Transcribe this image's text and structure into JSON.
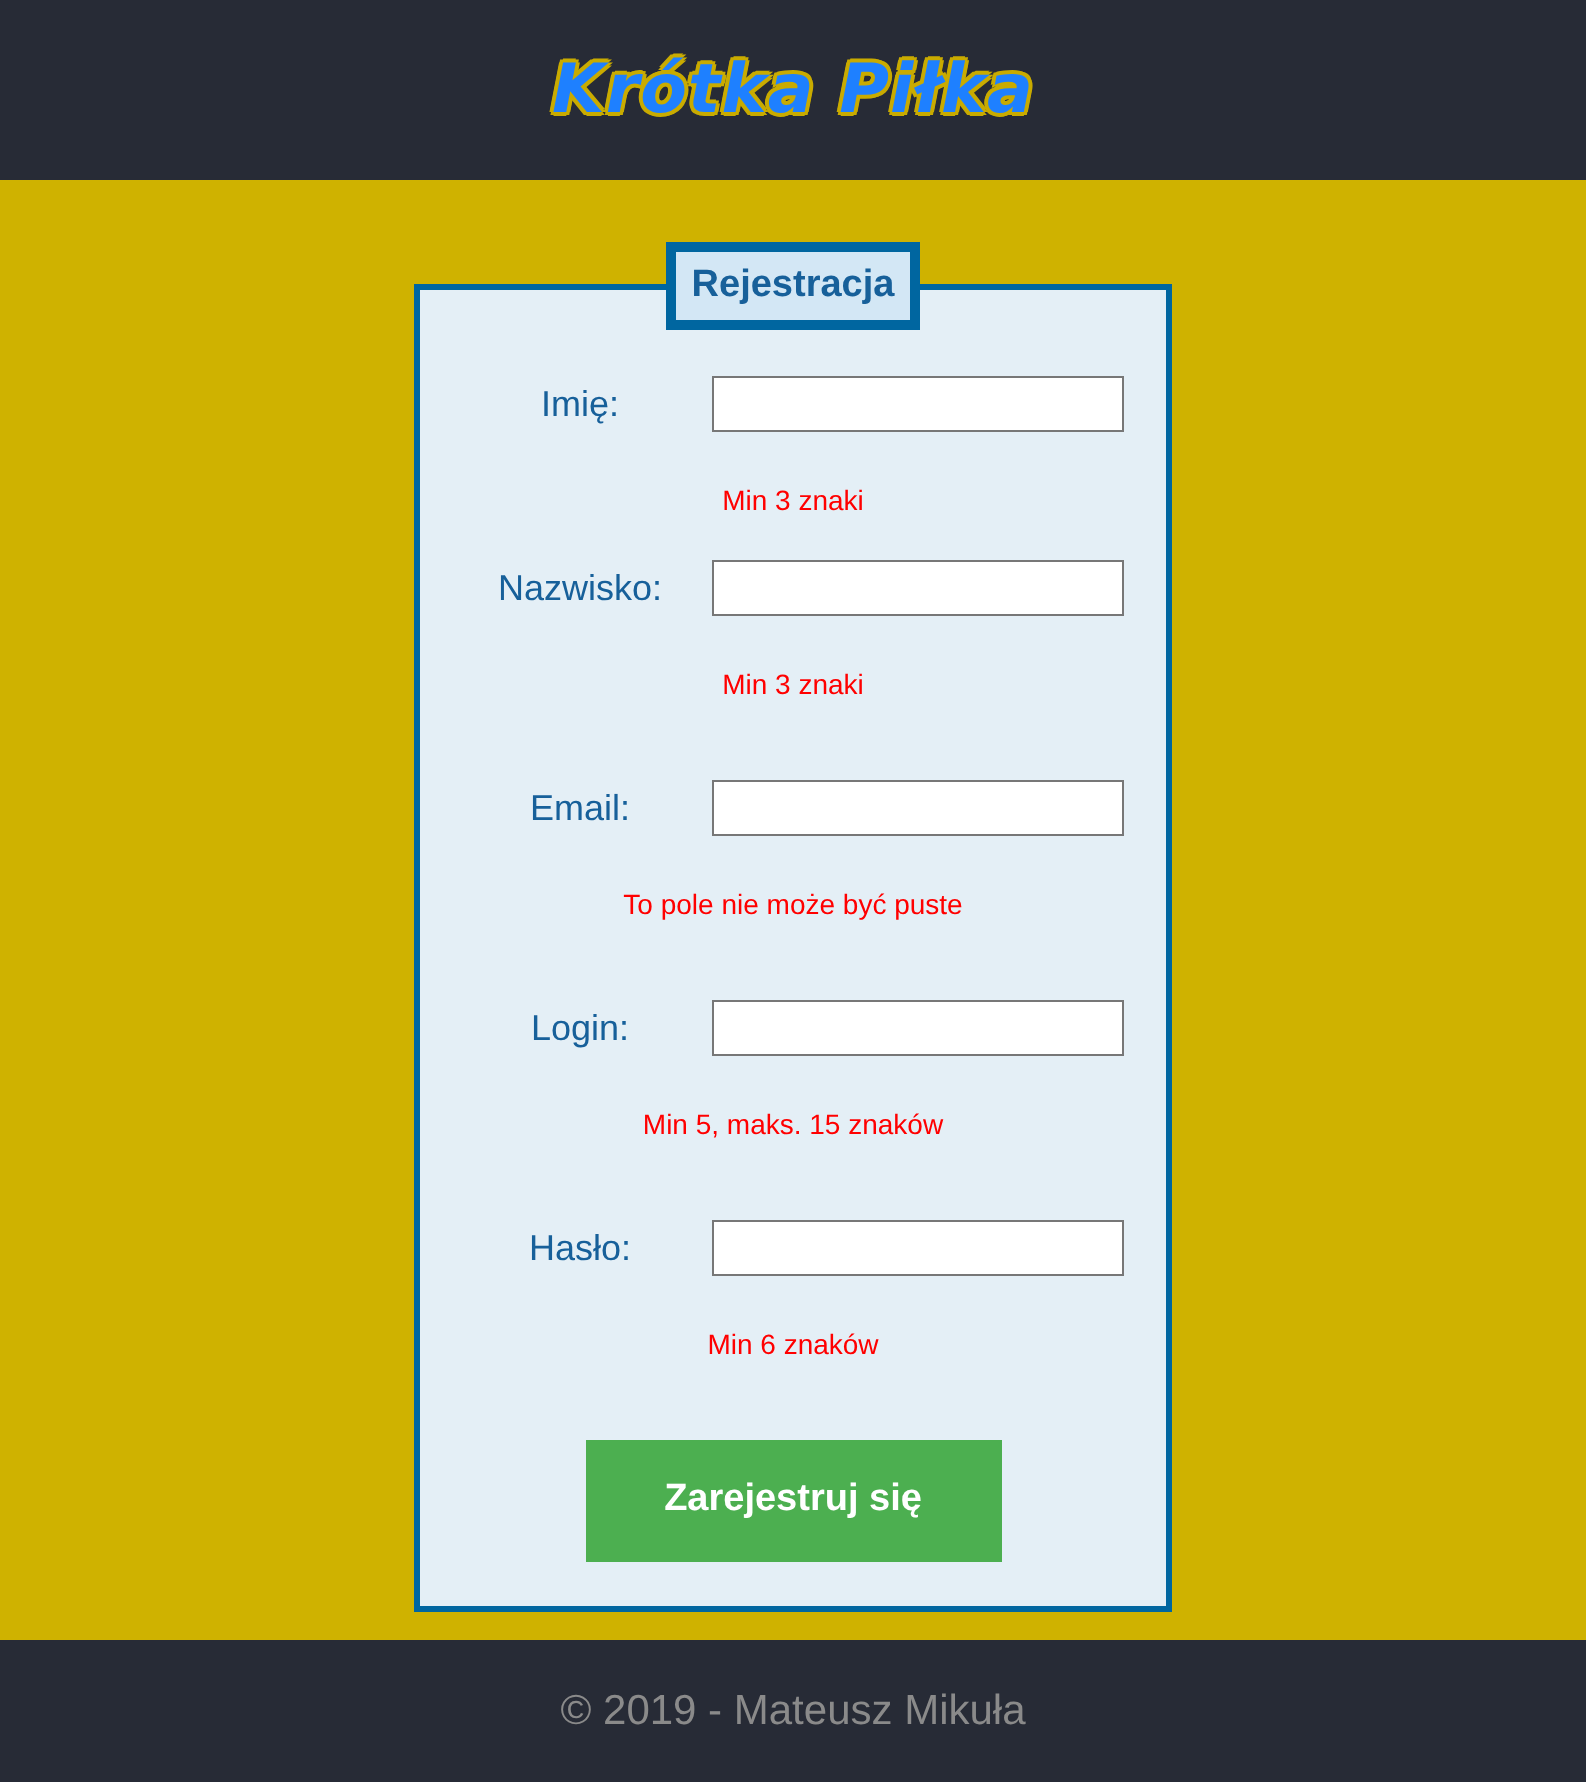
{
  "header": {
    "title": "Krótka Piłka"
  },
  "form": {
    "legend": "Rejestracja",
    "fields": [
      {
        "label": "Imię:",
        "hint": "Min 3 znaki"
      },
      {
        "label": "Nazwisko:",
        "hint": "Min 3 znaki"
      },
      {
        "label": "Email:",
        "hint": "To pole nie może być puste"
      },
      {
        "label": "Login:",
        "hint": "Min 5, maks. 15 znaków"
      },
      {
        "label": "Hasło:",
        "hint": "Min 6 znaków"
      }
    ],
    "submit": "Zarejestruj się"
  },
  "footer": {
    "text": "© 2019 - Mateusz Mikuła"
  }
}
